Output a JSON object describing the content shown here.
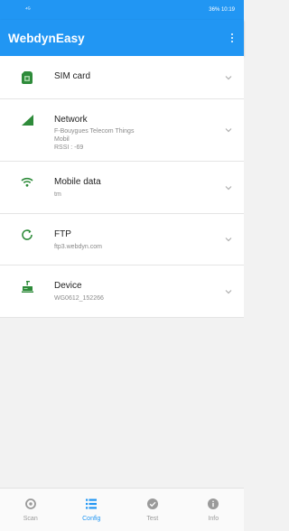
{
  "status_bar": {
    "left_text": "⁴ᴳ",
    "right_text": "36% 10:19"
  },
  "app_bar": {
    "title": "WebdynEasy",
    "menu_icon": "more-vert-icon"
  },
  "config_items": [
    {
      "icon": "sim-card-icon",
      "title": "SIM card",
      "lines": []
    },
    {
      "icon": "signal-icon",
      "title": "Network",
      "lines": [
        "F-Bouygues Telecom Things",
        "Mobil",
        "RSSI : -69"
      ]
    },
    {
      "icon": "wifi-icon",
      "title": "Mobile data",
      "lines": [
        "tm"
      ]
    },
    {
      "icon": "ftp-icon",
      "title": "FTP",
      "lines": [
        "ftp3.webdyn.com"
      ]
    },
    {
      "icon": "device-icon",
      "title": "Device",
      "lines": [
        "WG0612_152266"
      ]
    }
  ],
  "bottom_nav": [
    {
      "icon": "scan-icon",
      "label": "Scan",
      "active": false
    },
    {
      "icon": "config-icon",
      "label": "Config",
      "active": true
    },
    {
      "icon": "test-icon",
      "label": "Test",
      "active": false
    },
    {
      "icon": "info-icon",
      "label": "Info",
      "active": false
    }
  ],
  "colors": {
    "primary": "#2196f3",
    "icon_green": "#2e8b3a",
    "nav_inactive": "#9a9a9a"
  }
}
